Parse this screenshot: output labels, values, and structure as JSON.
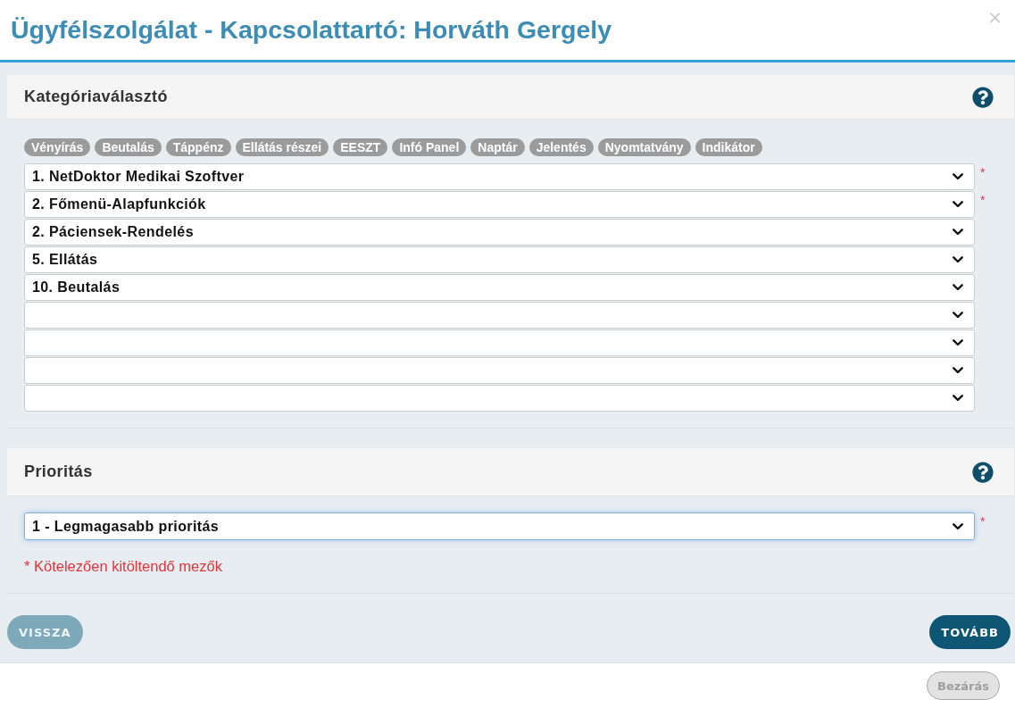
{
  "window": {
    "title": "Ügyfélszolgálat - Kapcsolattartó: Horváth Gergely",
    "close_label": "×"
  },
  "sections": [
    {
      "title": "Kategóriaválasztó",
      "tags": [
        "Vényírás",
        "Beutalás",
        "Táppénz",
        "Ellátás részei",
        "EESZT",
        "Infó Panel",
        "Naptár",
        "Jelentés",
        "Nyomtatvány",
        "Indikátor"
      ],
      "selects": [
        {
          "value": "1. NetDoktor Medikai Szoftver",
          "mark": "*",
          "focused": false
        },
        {
          "value": "2. Főmenü-Alapfunkciók",
          "mark": "*",
          "focused": false
        },
        {
          "value": "2. Páciensek-Rendelés",
          "focused": false
        },
        {
          "value": "5. Ellátás",
          "focused": false
        },
        {
          "value": "10. Beutalás",
          "focused": false
        },
        {
          "focused": false
        },
        {
          "focused": false
        },
        {
          "focused": false
        },
        {
          "focused": false
        }
      ]
    },
    {
      "title": "Prioritás",
      "selects": [
        {
          "value": "1 - Legmagasabb prioritás",
          "mark": "*",
          "focused": true
        }
      ],
      "note": "* Kötelezően kitöltendő mezők"
    }
  ],
  "nav_buttons": [
    {
      "kind": "back",
      "label": "VISSZA",
      "disabled": true
    },
    {
      "kind": "next",
      "label": "TOVÁBB",
      "disabled": false
    }
  ],
  "footer": {
    "close_button": {
      "label": "Bezárás",
      "disabled": true
    }
  }
}
